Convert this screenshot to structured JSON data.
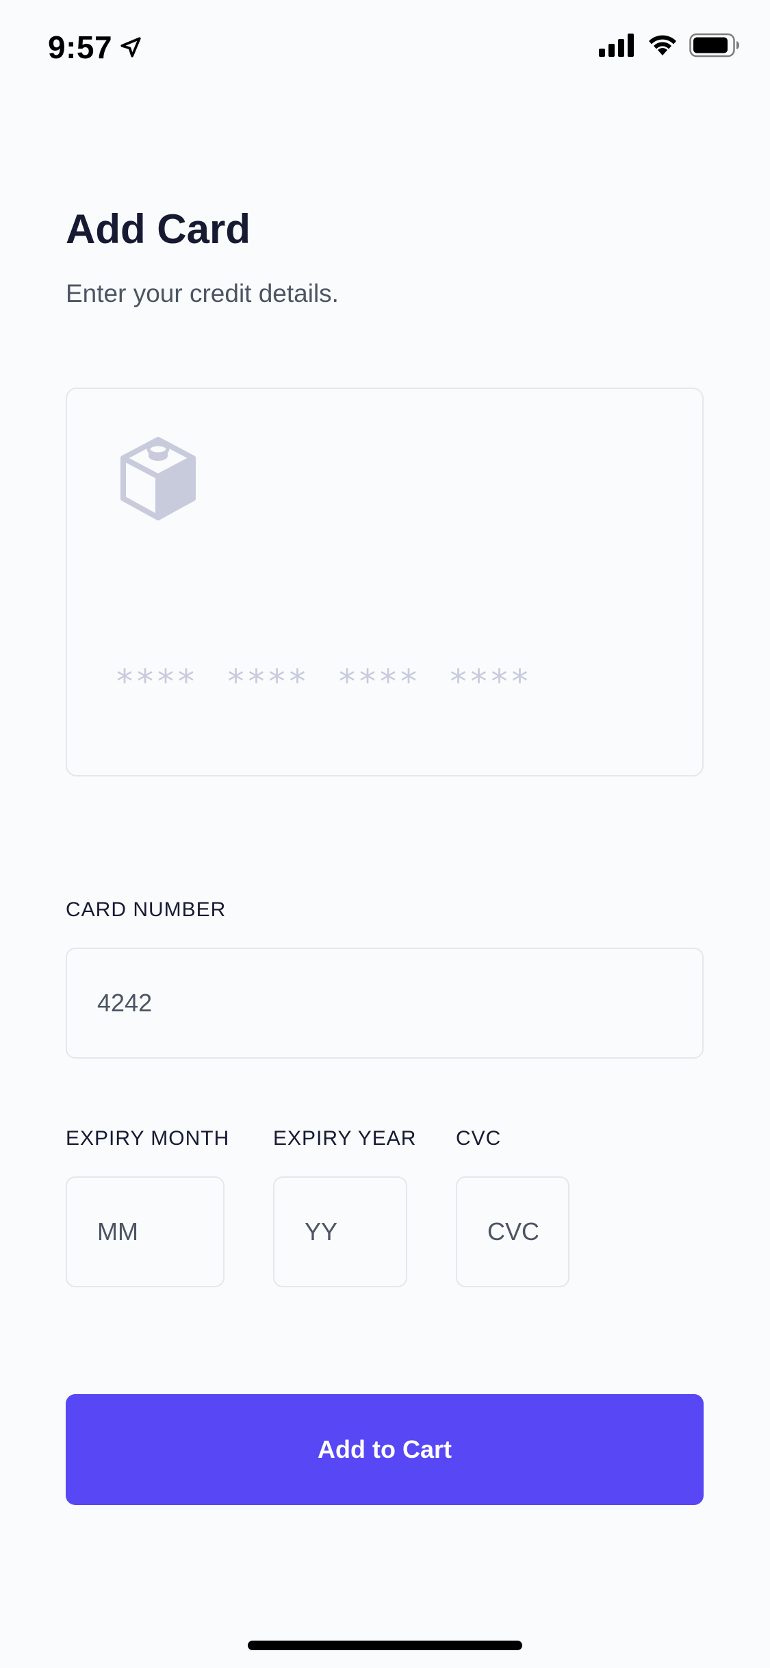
{
  "status_bar": {
    "time": "9:57",
    "icons": [
      "location-arrow-icon",
      "cellular-signal-icon",
      "wifi-icon",
      "battery-icon"
    ]
  },
  "header": {
    "title": "Add Card",
    "subtitle": "Enter your credit details."
  },
  "card_preview": {
    "logo_icon": "cube-icon",
    "masked_number": "****  ****  ****  ****"
  },
  "form": {
    "card_number": {
      "label": "CARD NUMBER",
      "value": "4242",
      "placeholder": ""
    },
    "expiry_month": {
      "label": "EXPIRY MONTH",
      "value": "",
      "placeholder": "MM"
    },
    "expiry_year": {
      "label": "EXPIRY YEAR",
      "value": "",
      "placeholder": "YY"
    },
    "cvc": {
      "label": "CVC",
      "value": "",
      "placeholder": "CVC"
    }
  },
  "actions": {
    "add_to_cart_label": "Add to Cart"
  },
  "colors": {
    "accent": "#5747f5",
    "background": "#fafbfc",
    "border": "#e5e7eb",
    "title": "#161a33",
    "muted": "#c7cbdc"
  }
}
